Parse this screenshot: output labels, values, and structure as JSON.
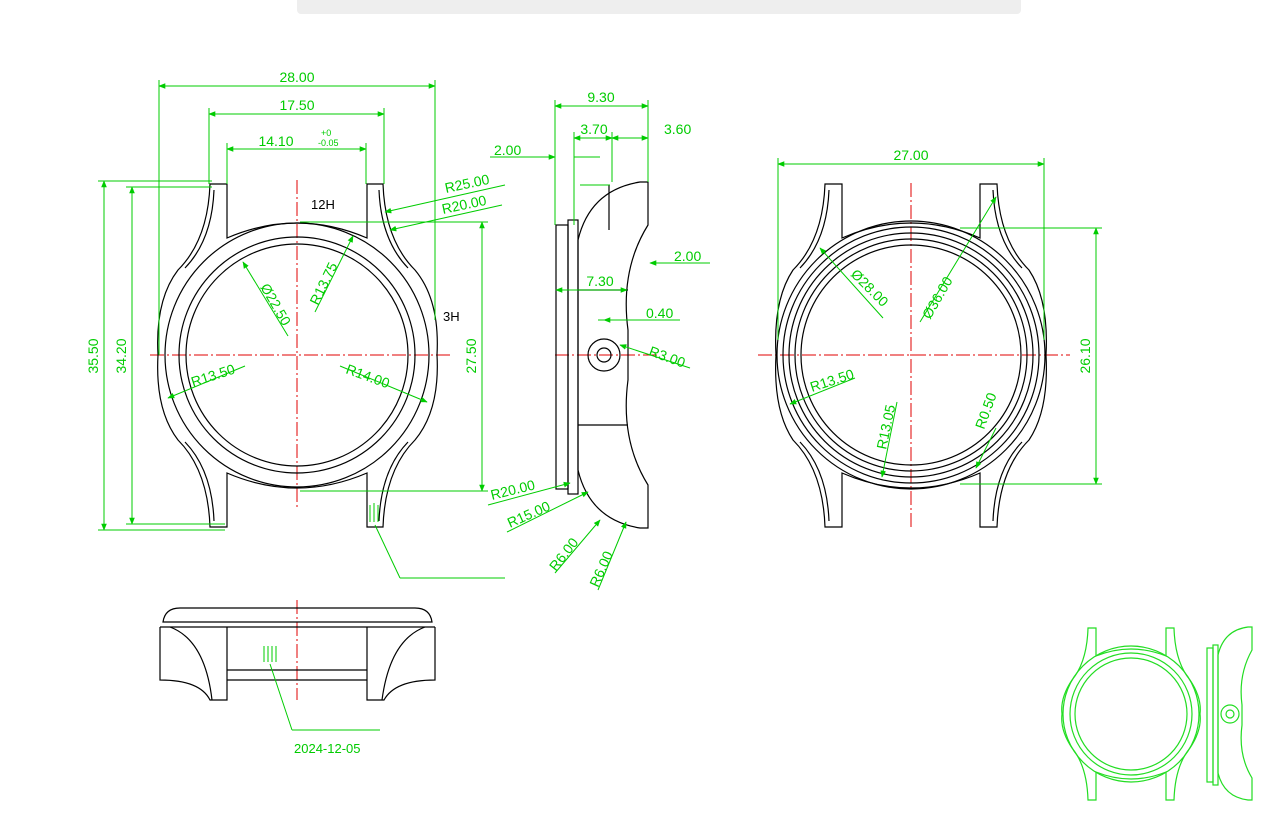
{
  "colors": {
    "outline": "#000000",
    "dimension": "#00cc00",
    "centerline": "#e00000",
    "thumbnail": "#22dd22",
    "background": "#ffffff"
  },
  "front_view": {
    "width_total": "28.00",
    "width_lug": "17.50",
    "width_inner": "14.10",
    "tol_upper": "+0",
    "tol_lower": "-0.05",
    "label_12h": "12H",
    "label_3h": "3H",
    "r25": "R25.00",
    "r20": "R20.00",
    "r13_75": "R13.75",
    "d22_50": "Ø22.50",
    "r13_50": "R13.50",
    "r14": "R14.00",
    "height_total": "35.50",
    "height_inner": "34.20",
    "height_case": "27.50"
  },
  "side_view": {
    "depth": "9.30",
    "d3_70": "3.70",
    "d3_60": "3.60",
    "d2_00_left": "2.00",
    "d2_00_right": "2.00",
    "d7_30": "7.30",
    "d0_40": "0.40",
    "r3": "R3.00",
    "r20": "R20.00",
    "r15": "R15.00",
    "r6_a": "R6.00",
    "r6_b": "R6.00"
  },
  "back_view": {
    "width": "27.00",
    "d28": "Ø28.00",
    "d36": "Ø36.00",
    "height": "26.10",
    "r13_50": "R13.50",
    "r13_05": "R13.05",
    "r0_50": "R0.50"
  },
  "bottom_view": {
    "date": "2024-12-05"
  }
}
